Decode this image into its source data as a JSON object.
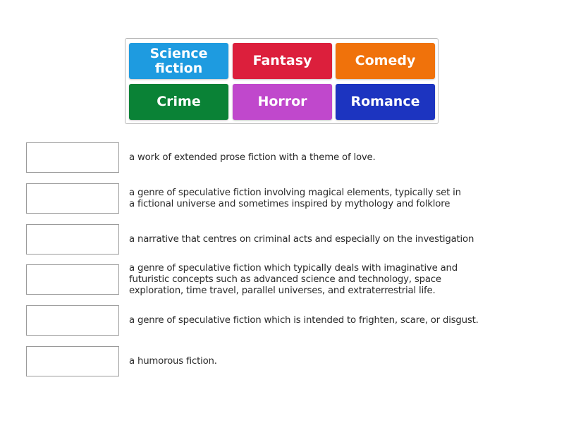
{
  "tiles": [
    {
      "label": "Science\nfiction",
      "color": "#1e9be0"
    },
    {
      "label": "Fantasy",
      "color": "#dc1f3c"
    },
    {
      "label": "Comedy",
      "color": "#f0720b"
    },
    {
      "label": "Crime",
      "color": "#0a8236"
    },
    {
      "label": "Horror",
      "color": "#c048cc"
    },
    {
      "label": "Romance",
      "color": "#1c34c0"
    }
  ],
  "rows": [
    {
      "slot_value": "",
      "description": "a work of extended prose fiction with a theme of love."
    },
    {
      "slot_value": "",
      "description": "a genre of speculative fiction involving magical elements, typically set in\na fictional universe and sometimes inspired by mythology and folklore"
    },
    {
      "slot_value": "",
      "description": "a narrative that centres on criminal acts and especially on the investigation"
    },
    {
      "slot_value": "",
      "description": "a genre of speculative fiction which typically deals with imaginative and\nfuturistic concepts such as advanced science and technology, space\nexploration, time travel, parallel universes, and extraterrestrial life."
    },
    {
      "slot_value": "",
      "description": "a genre of speculative fiction which is intended to frighten, scare, or disgust."
    },
    {
      "slot_value": "",
      "description": "a humorous fiction."
    }
  ]
}
